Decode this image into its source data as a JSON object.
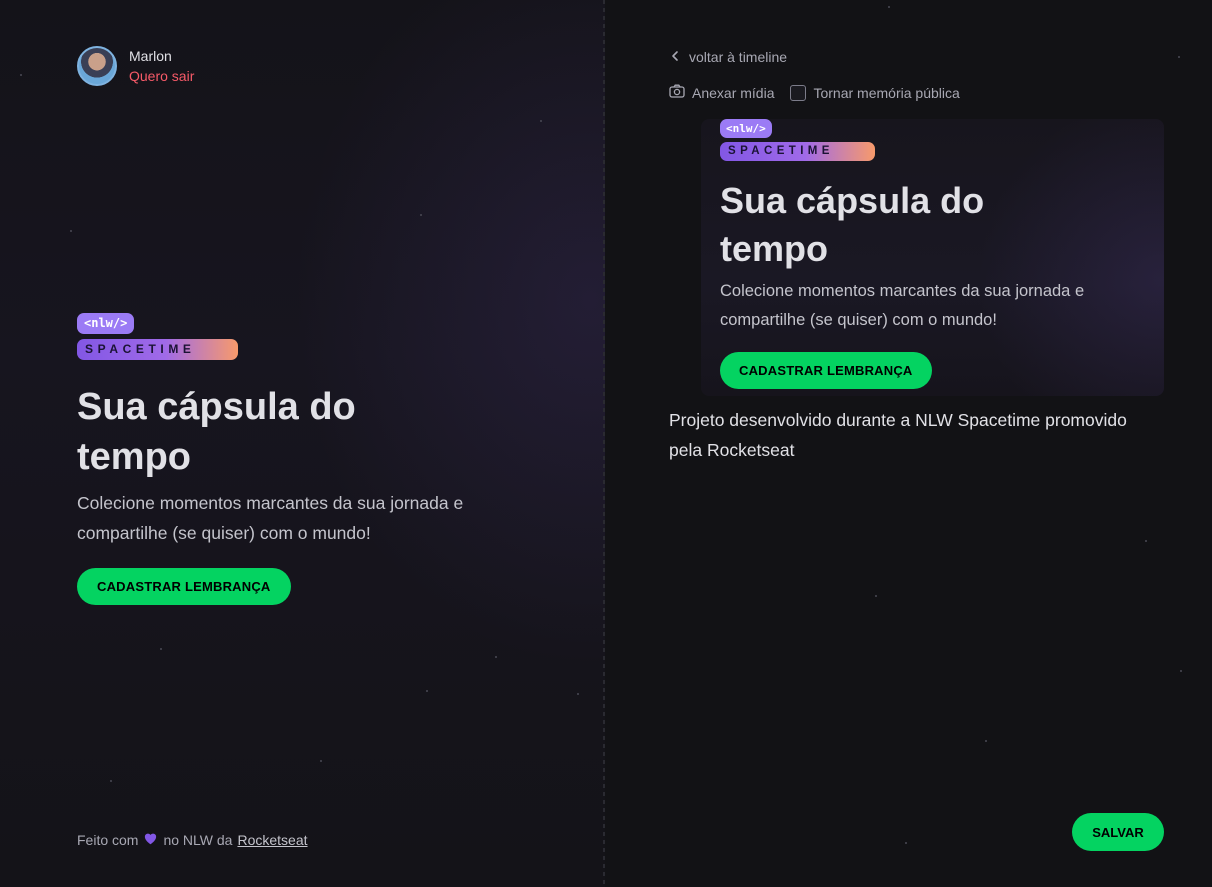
{
  "profile": {
    "name": "Marlon",
    "logout_label": "Quero sair"
  },
  "hero": {
    "logo_tag": "<nlw/>",
    "logo_word": "SPACETIME",
    "title": "Sua cápsula do tempo",
    "description": "Colecione momentos marcantes da sua jornada e compartilhe (se quiser) com o mundo!",
    "cta_label": "CADASTRAR LEMBRANÇA"
  },
  "footer": {
    "prefix": "Feito com",
    "middle": "no NLW da",
    "link": "Rocketseat",
    "heart_icon": "heart-icon"
  },
  "editor": {
    "back_label": "voltar à timeline",
    "attach_label": "Anexar mídia",
    "public_label": "Tornar memória pública",
    "public_checked": false,
    "content": "Projeto desenvolvido durante a NLW Spacetime promovido pela Rocketseat",
    "save_label": "SALVAR"
  },
  "colors": {
    "accent_green": "#04d361",
    "logout_red": "#f75a68",
    "purple": "#8257e5"
  }
}
